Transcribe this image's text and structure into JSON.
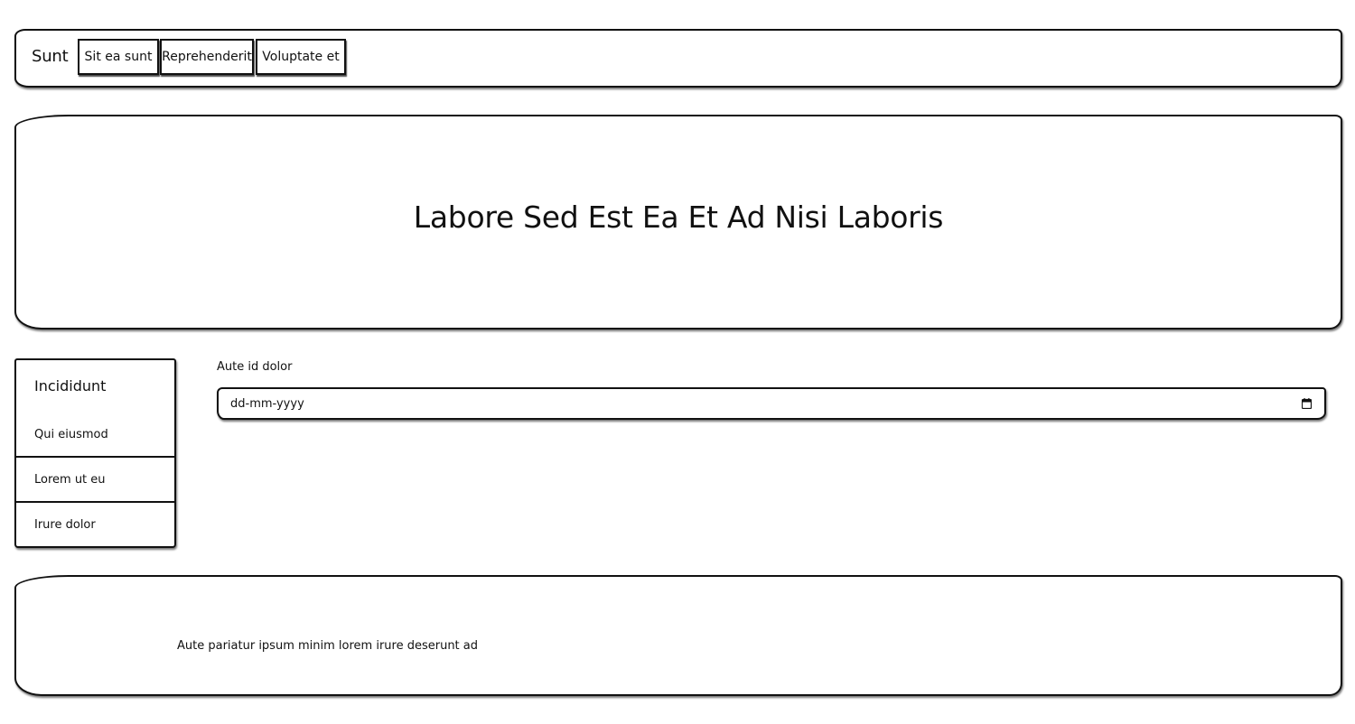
{
  "navbar": {
    "brand": "Sunt",
    "links": [
      "Sit ea sunt",
      "Reprehenderit",
      "Voluptate et"
    ]
  },
  "hero": {
    "title": "Labore Sed Est Ea Et Ad Nisi Laboris"
  },
  "sidebar": {
    "heading": "Incididunt",
    "items": [
      "Qui eiusmod",
      "Lorem ut eu",
      "Irure dolor"
    ]
  },
  "form": {
    "date_label": "Aute id dolor",
    "date_placeholder": "dd-mm-yyyy"
  },
  "footer": {
    "text": "Aute pariatur ipsum minim lorem irure deserunt ad"
  },
  "icons": {
    "calendar": "calendar-icon"
  }
}
